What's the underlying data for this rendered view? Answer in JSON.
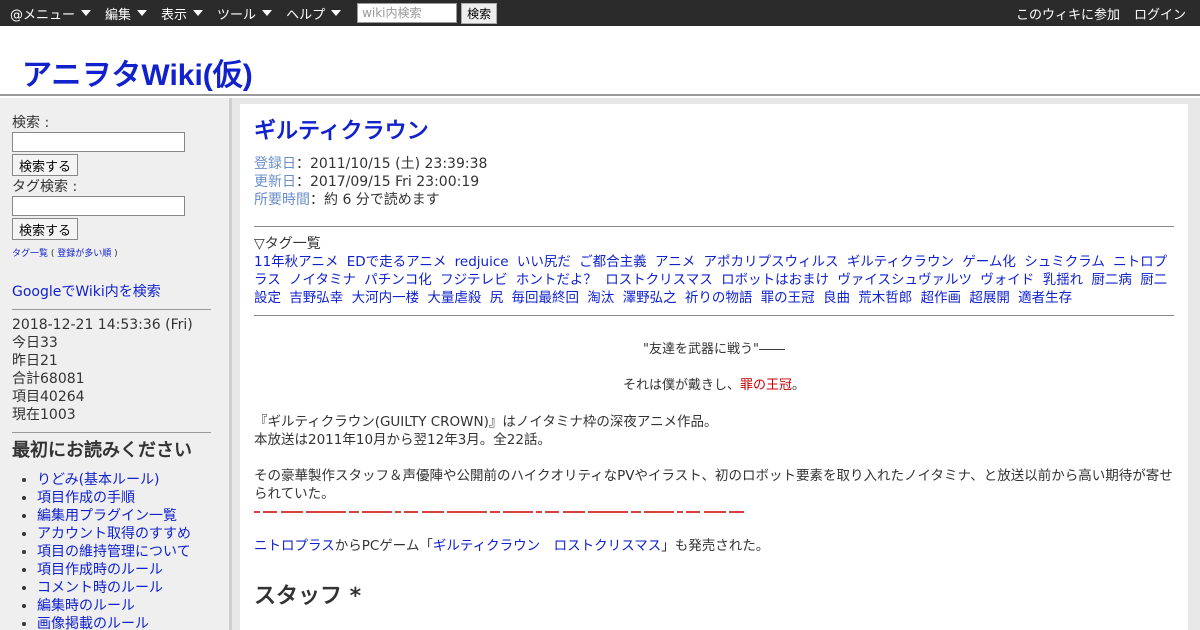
{
  "toolbar": {
    "menus": [
      "@メニュー",
      "編集",
      "表示",
      "ツール",
      "ヘルプ"
    ],
    "search_placeholder": "wiki内検索",
    "search_button": "検索",
    "join_label": "このウィキに参加",
    "login_label": "ログイン"
  },
  "header": {
    "site_title": "アニヲタWiki(仮)"
  },
  "sidebar": {
    "search_label": "検索 :",
    "search_button": "検索する",
    "tag_search_label": "タグ検索 :",
    "tag_search_button": "検索する",
    "tag_list_link": "タグ一覧",
    "tag_list_open": " ( ",
    "tag_popular_link": "登録が多い順",
    "tag_list_close": " )",
    "google_search": "GoogleでWiki内を検索",
    "stats": {
      "datetime": "2018-12-21 14:53:36 (Fri)",
      "today": "今日33",
      "yesterday": "昨日21",
      "total": "合計68081",
      "items": "項目40264",
      "current": "現在1003"
    },
    "read_first_heading": "最初にお読みください",
    "read_first_items": [
      "りどみ(基本ルール)",
      "項目作成の手順",
      "編集用プラグイン一覧",
      "アカウント取得のすすめ",
      "項目の維持管理について",
      "項目作成時のルール",
      "コメント時のルール",
      "編集時のルール",
      "画像掲載のルール"
    ]
  },
  "article": {
    "title": "ギルティクラウン",
    "registered_label": "登録日",
    "registered_value": "：2011/10/15 (土) 23:39:38",
    "updated_label": "更新日",
    "updated_value": "：2017/09/15 Fri 23:00:19",
    "reading_label": "所要時間",
    "reading_value": "：約 6 分で読めます",
    "tag_heading": "▽タグ一覧",
    "tags": [
      "11年秋アニメ",
      "EDで走るアニメ",
      "redjuice",
      "いい尻だ",
      "ご都合主義",
      "アニメ",
      "アポカリプスウィルス",
      "ギルティクラウン",
      "ゲーム化",
      "シュミクラム",
      "ニトロプラス",
      "ノイタミナ",
      "パチンコ化",
      "フジテレビ",
      "ホントだよ？",
      "ロストクリスマス",
      "ロボットはおまけ",
      "ヴァイスシュヴァルツ",
      "ヴォイド",
      "乳揺れ",
      "厨二病",
      "厨二設定",
      "吉野弘幸",
      "大河内一楼",
      "大量虐殺",
      "尻",
      "毎回最終回",
      "淘汰",
      "澤野弘之",
      "祈りの物語",
      "罪の王冠",
      "良曲",
      "荒木哲郎",
      "超作画",
      "超展開",
      "適者生存"
    ],
    "quote1": "\"友達を武器に戦う\"――",
    "quote2_prefix": "それは僕が戴きし、",
    "quote2_red": "罪の王冠",
    "quote2_suffix": "。",
    "p1": "『ギルティクラウン(GUILTY CROWN)』はノイタミナ枠の深夜アニメ作品。",
    "p2": "本放送は2011年10月から翌12年3月。全22話。",
    "p3": "その豪華製作スタッフ＆声優陣や公開前のハイクオリティなPVやイラスト、初のロボット要素を取り入れたノイタミナ、と放送以前から高い期待が寄せられていた。",
    "p4_link1": "ニトロプラス",
    "p4_mid": "からPCゲーム「",
    "p4_link2": "ギルティクラウン　ロストクリスマス",
    "p4_end": "」も発売された。",
    "staff_heading": "スタッフ *"
  },
  "colors": {
    "toolbar_bg": "#2b2b2b",
    "link": "#1122cc",
    "meta_label": "#6a8fc8",
    "accent_red": "#cc0000"
  }
}
